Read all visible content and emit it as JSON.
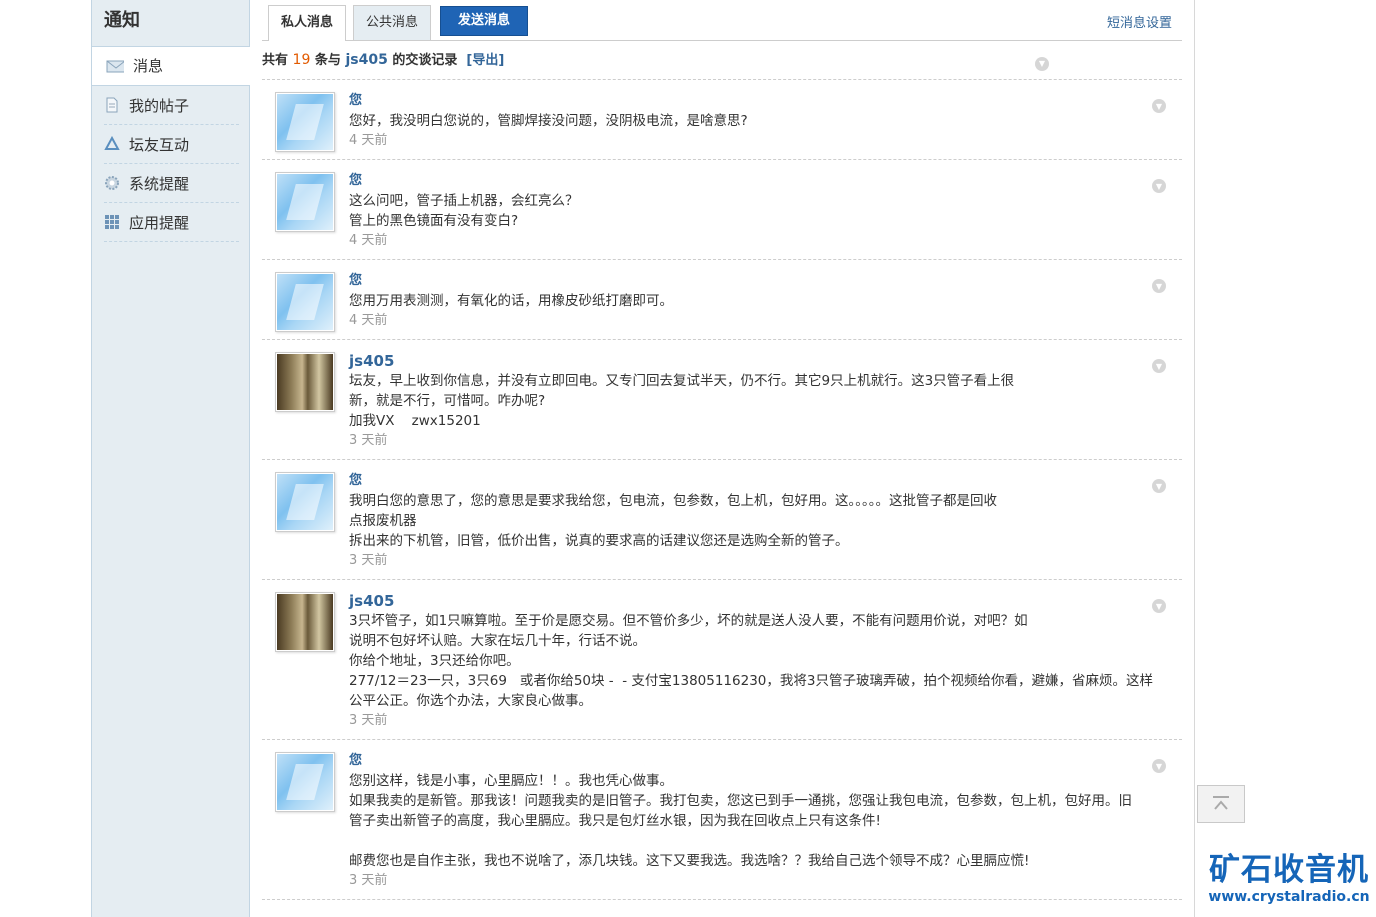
{
  "sidebar": {
    "title": "通知",
    "items": [
      {
        "label": "消息",
        "icon": "envelope-icon"
      },
      {
        "label": "我的帖子",
        "icon": "document-icon"
      },
      {
        "label": "坛友互动",
        "icon": "recycle-icon"
      },
      {
        "label": "系统提醒",
        "icon": "gear-icon"
      },
      {
        "label": "应用提醒",
        "icon": "grid-icon"
      }
    ]
  },
  "tabs": {
    "private": "私人消息",
    "public": "公共消息",
    "send": "发送消息",
    "settings": "短消息设置"
  },
  "summary": {
    "prefix": "共有",
    "count": "19",
    "middle": "条与",
    "user": "js405",
    "suffix": "的交谈记录",
    "export": "[导出]"
  },
  "messages": [
    {
      "author": "您",
      "avatar": "you",
      "body": "您好，我没明白您说的，管脚焊接没问题，没阴极电流，是啥意思?",
      "time": "4 天前"
    },
    {
      "author": "您",
      "avatar": "you",
      "body": "这么问吧，管子插上机器，会红亮么？\n管上的黑色镜面有没有变白?",
      "time": "4 天前"
    },
    {
      "author": "您",
      "avatar": "you",
      "body": "您用万用表测测，有氧化的话，用橡皮砂纸打磨即可。",
      "time": "4 天前"
    },
    {
      "author": "js405",
      "avatar": "js",
      "body": "坛友，早上收到你信息，并没有立即回电。又专门回去复试半天，仍不行。其它9只上机就行。这3只管子看上很\n新，就是不行，可惜呵。咋办呢?\n加我VX    zwx15201",
      "time": "3 天前"
    },
    {
      "author": "您",
      "avatar": "you",
      "body": "我明白您的意思了，您的意思是要求我给您，包电流，包参数，包上机，包好用。这。。。。。这批管子都是回收\n点报废机器\n拆出来的下机管，旧管，低价出售，说真的要求高的话建议您还是选购全新的管子。",
      "time": "3 天前"
    },
    {
      "author": "js405",
      "avatar": "js",
      "body": "3只坏管子，如1只嘛算啦。至于价是愿交易。但不管价多少，坏的就是送人没人要，不能有问题用价说，对吧？如\n说明不包好坏认赔。大家在坛几十年，行话不说。\n你给个地址，3只还给你吧。\n277/12＝23一只，3只69   或者你给50块 -  - 支付宝13805116230，我将3只管子玻璃弄破，拍个视频给你看，避嫌，省麻烦。这样\n公平公正。你选个办法，大家良心做事。",
      "time": "3 天前"
    },
    {
      "author": "您",
      "avatar": "you",
      "body": "您别这样，钱是小事，心里膈应！！。我也凭心做事。\n如果我卖的是新管。那我该！问题我卖的是旧管子。我打包卖，您这已到手一通挑，您强让我包电流，包参数，包上机，包好用。旧\n管子卖出新管子的高度，我心里膈应。我只是包灯丝水银，因为我在回收点上只有这条件!\n\n邮费您也是自作主张，我也不说啥了，添几块钱。这下又要我选。我选啥？？我给自己选个领导不成？心里膈应慌!",
      "time": "3 天前"
    }
  ],
  "brand": {
    "name": "矿石收音机",
    "url": "www.crystalradio.cn"
  },
  "colors": {
    "link": "#336699",
    "count": "#e25a00",
    "send_button": "#1f64b5",
    "sidebar_bg": "#e5edf2"
  }
}
